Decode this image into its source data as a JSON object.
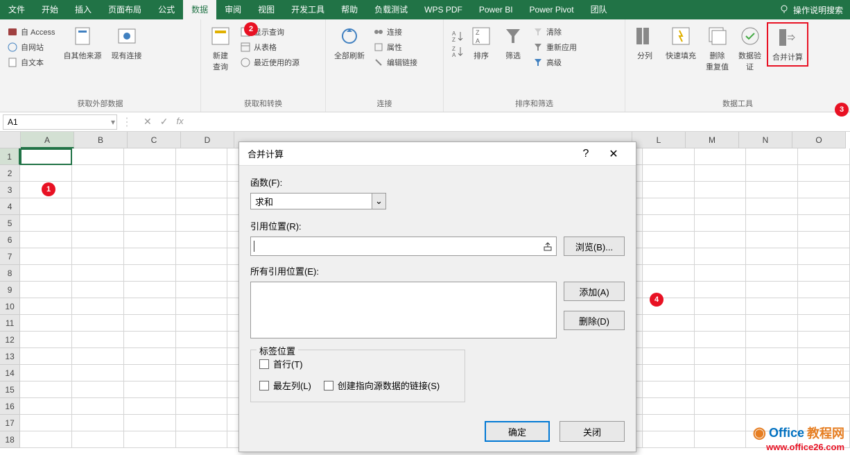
{
  "menubar": {
    "items": [
      "文件",
      "开始",
      "插入",
      "页面布局",
      "公式",
      "数据",
      "审阅",
      "视图",
      "开发工具",
      "帮助",
      "负载测试",
      "WPS PDF",
      "Power BI",
      "Power Pivot",
      "团队"
    ],
    "active_index": 5,
    "help_search": "操作说明搜索"
  },
  "markers": {
    "m1": "1",
    "m2": "2",
    "m3": "3",
    "m4": "4"
  },
  "ribbon": {
    "groups": [
      {
        "label": "获取外部数据",
        "small_items": [
          "自 Access",
          "自网站",
          "自文本"
        ],
        "large_items": [
          "自其他来源",
          "现有连接"
        ]
      },
      {
        "label": "获取和转换",
        "large_items": [
          "新建\n查询"
        ],
        "small_items": [
          "显示查询",
          "从表格",
          "最近使用的源"
        ]
      },
      {
        "label": "连接",
        "large_items": [
          "全部刷新"
        ],
        "small_items": [
          "连接",
          "属性",
          "编辑链接"
        ]
      },
      {
        "label": "排序和筛选",
        "large_items": [
          "排序",
          "筛选"
        ],
        "small_items": [
          "清除",
          "重新应用",
          "高级"
        ]
      },
      {
        "label": "数据工具",
        "large_items": [
          "分列",
          "快速填充",
          "删除\n重复值",
          "数据验\n证",
          "合并计算"
        ]
      }
    ]
  },
  "formula_bar": {
    "name_box": "A1",
    "cancel": "✕",
    "enter": "✓",
    "fx": "fx",
    "formula": ""
  },
  "sheet": {
    "columns": [
      "A",
      "B",
      "C",
      "D",
      "",
      "",
      "",
      "",
      "",
      "",
      "",
      "L",
      "M",
      "N",
      "O"
    ],
    "active_col_index": 0,
    "rows": 18,
    "active_row": 1
  },
  "dialog": {
    "title": "合并计算",
    "help": "?",
    "close": "✕",
    "function_label": "函数(F):",
    "function_value": "求和",
    "ref_label": "引用位置(R):",
    "ref_value": "",
    "browse_btn": "浏览(B)...",
    "all_refs_label": "所有引用位置(E):",
    "add_btn": "添加(A)",
    "delete_btn": "删除(D)",
    "label_pos_legend": "标签位置",
    "chk_first_row": "首行(T)",
    "chk_left_col": "最左列(L)",
    "chk_link": "创建指向源数据的链接(S)",
    "ok_btn": "确定",
    "close_btn": "关闭"
  },
  "watermark": {
    "office": "Office",
    "jiaocheng": "教程网",
    "url": "www.office26.com"
  }
}
